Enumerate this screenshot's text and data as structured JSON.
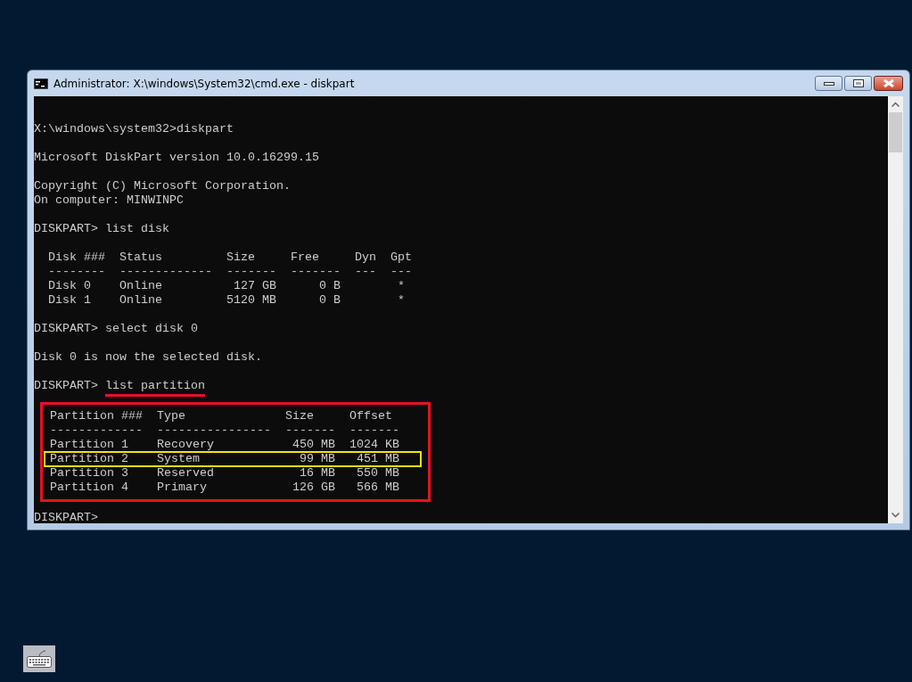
{
  "window": {
    "title": "Administrator: X:\\windows\\System32\\cmd.exe - diskpart"
  },
  "console": {
    "blocks": [
      {
        "kind": "plain",
        "lines": [
          {
            "text": "X:\\windows\\system32>diskpart"
          }
        ]
      },
      {
        "kind": "plain",
        "lines": [
          {
            "text": "Microsoft DiskPart version 10.0.16299.15"
          }
        ]
      },
      {
        "kind": "plain",
        "lines": [
          {
            "text": "Copyright (C) Microsoft Corporation."
          },
          {
            "text": "On computer: MINWINPC"
          }
        ]
      },
      {
        "kind": "plain",
        "lines": [
          {
            "text": "DISKPART> list disk"
          }
        ]
      },
      {
        "kind": "plain",
        "lines": [
          {
            "text": "  Disk ###  Status         Size     Free     Dyn  Gpt"
          },
          {
            "text": "  --------  -------------  -------  -------  ---  ---"
          },
          {
            "text": "  Disk 0    Online          127 GB      0 B        *"
          },
          {
            "text": "  Disk 1    Online         5120 MB      0 B        *"
          }
        ]
      },
      {
        "kind": "plain",
        "lines": [
          {
            "text": "DISKPART> select disk 0"
          }
        ]
      },
      {
        "kind": "plain",
        "lines": [
          {
            "text": "Disk 0 is now the selected disk."
          }
        ]
      },
      {
        "kind": "plain",
        "lines": [
          {
            "text": "DISKPART> ",
            "underlined": "list partition"
          }
        ]
      },
      {
        "kind": "boxed",
        "lines": [
          {
            "text": "Partition ###  Type              Size     Offset",
            "highlighted": false
          },
          {
            "text": "-------------  ----------------  -------  -------",
            "highlighted": false
          },
          {
            "text": "Partition 1    Recovery           450 MB  1024 KB",
            "highlighted": false
          },
          {
            "text": "Partition 2    System              99 MB   451 MB",
            "highlighted": true
          },
          {
            "text": "Partition 3    Reserved            16 MB   550 MB",
            "highlighted": false
          },
          {
            "text": "Partition 4    Primary            126 GB   566 MB",
            "highlighted": false
          }
        ]
      },
      {
        "kind": "plain",
        "lines": [
          {
            "text": "DISKPART>"
          }
        ]
      }
    ]
  }
}
